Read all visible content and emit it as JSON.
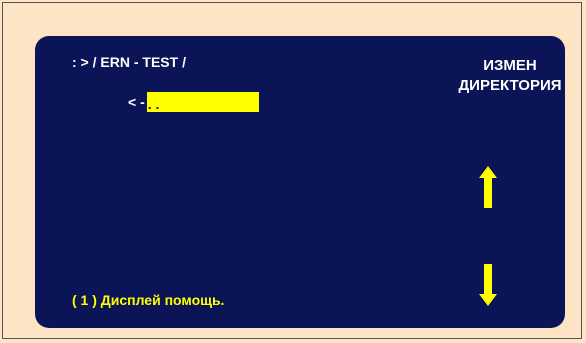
{
  "screen": {
    "path": ": > / ERN - TEST /",
    "entry_marker": "< -",
    "entry_name": ". .",
    "title_line1": "ИЗМЕН",
    "title_line2": "ДИРЕКТОРИЯ",
    "help_text": "( 1 ) Дисплей помощь.",
    "scroll_up_icon": "arrow-up-icon",
    "scroll_down_icon": "arrow-down-icon"
  },
  "colors": {
    "page_background": "#fde4c4",
    "screen_background": "#0a1456",
    "highlight": "#ffff00",
    "text": "#ffffff",
    "accent_text": "#ffff00"
  }
}
